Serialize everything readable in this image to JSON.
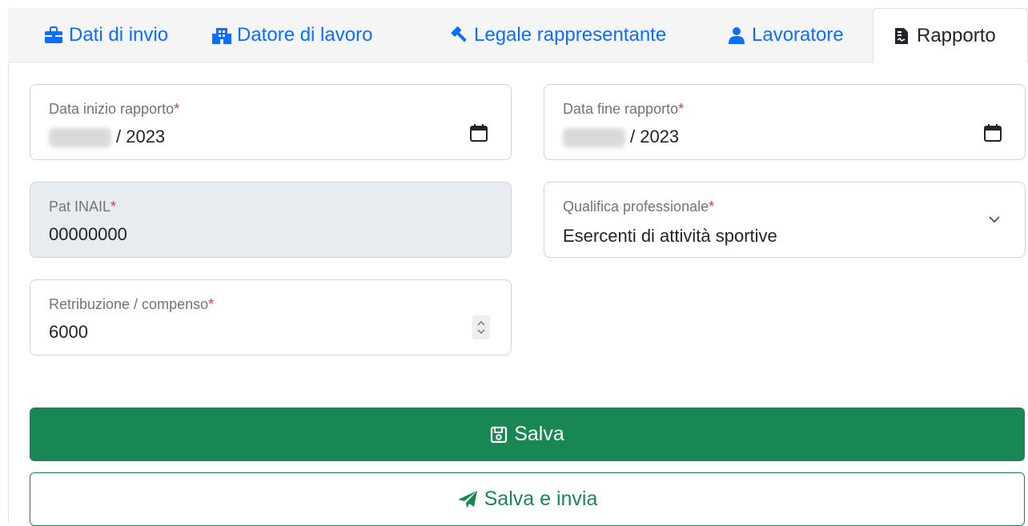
{
  "tabs": [
    {
      "label": "Dati di invio",
      "icon": "briefcase-icon"
    },
    {
      "label": "Datore di lavoro",
      "icon": "building-icon"
    },
    {
      "label": "Legale rappresentante",
      "icon": "gavel-icon"
    },
    {
      "label": "Lavoratore",
      "icon": "user-icon"
    },
    {
      "label": "Rapporto",
      "icon": "file-contract-icon",
      "active": true
    }
  ],
  "form": {
    "data_inizio": {
      "label": "Data inizio rapporto",
      "required_mark": "*",
      "value": "/ 2023"
    },
    "data_fine": {
      "label": "Data fine rapporto",
      "required_mark": "*",
      "value": "/ 2023"
    },
    "pat_inail": {
      "label": "Pat INAIL",
      "required_mark": "*",
      "value": "00000000"
    },
    "qualifica": {
      "label": "Qualifica professionale",
      "required_mark": "*",
      "value": "Esercenti di attività sportive"
    },
    "retribuzione": {
      "label": "Retribuzione / compenso",
      "required_mark": "*",
      "value": "6000"
    }
  },
  "buttons": {
    "save": "Salva",
    "save_send": "Salva e invia"
  },
  "colors": {
    "link": "#0d6efd",
    "success": "#198754",
    "required": "#dc3545"
  }
}
